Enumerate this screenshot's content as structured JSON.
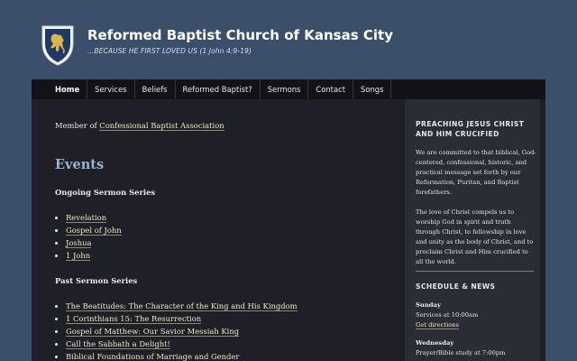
{
  "site": {
    "title": "Reformed Baptist Church of Kansas City",
    "tagline": "...BECAUSE HE FIRST LOVED US (1 John 4:9-19)",
    "logo_icon": "lion-shield-icon"
  },
  "nav": {
    "items": [
      "Home",
      "Services",
      "Beliefs",
      "Reformed Baptist?",
      "Sermons",
      "Contact",
      "Songs"
    ],
    "active": "Home"
  },
  "main": {
    "member_prefix": "Member of",
    "member_link": "Confessional Baptist Association",
    "events_heading": "Events",
    "ongoing_heading": "Ongoing Sermon Series",
    "ongoing": [
      "Revelation",
      "Gospel of John",
      "Joshua",
      "1 John"
    ],
    "past_heading": "Past Sermon Series",
    "past": [
      "The Beatitudes: The Character of the King and His Kingdom",
      "1 Corinthians 15: The Resurrection",
      "Gospel of Matthew: Our Savior Messiah King",
      "Call the Sabbath a Delight!",
      "Biblical Foundations of Marriage and Gender"
    ]
  },
  "sidebar": {
    "heading1": "PREACHING JESUS CHRIST AND HIM CRUCIFIED",
    "para1": "We are committed to that biblical, God-centered, confessional, historic, and practical message set forth by our Reformation, Puritan, and Baptist forefathers.",
    "para2": "The love of Christ compels us to worship God in spirit and truth through Christ, to fellowship in love and unity as the body of Christ, and to proclaim Christ and Him crucified to all the world.",
    "heading2": "SCHEDULE & NEWS",
    "sunday_day": "Sunday",
    "sunday_line": "Services at 10:00am",
    "sunday_link": "Get directions",
    "wednesday_day": "Wednesday",
    "wednesday_line": "Prayer/Bible study at 7:00pm"
  },
  "colors": {
    "page_bg": "#3b4f6b",
    "content_bg": "#1f2027",
    "nav_bg": "#121316",
    "sidebar_bg": "#2a2c36",
    "heading_blue": "#9bb2cf",
    "link": "#f1e6c4"
  }
}
